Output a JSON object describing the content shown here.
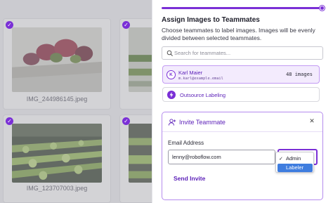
{
  "gallery": {
    "images": [
      {
        "filename": "",
        "checked": true
      },
      {
        "filename": "",
        "checked": true
      },
      {
        "filename": "IMG_244986145.jpeg",
        "checked": true
      },
      {
        "filename": "",
        "checked": true
      },
      {
        "filename": "IMG_123707003.jpeg",
        "checked": true
      },
      {
        "filename": "",
        "checked": true
      }
    ]
  },
  "assign": {
    "title": "Assign Images to Teammates",
    "description": "Choose teammates to label images. Images will be evenly divided between selected teammates.",
    "search_placeholder": "Search for teammates...",
    "teammate": {
      "initial": "K",
      "name": "Karl Maier",
      "email": "m.karl@example.email",
      "count": "48 images"
    },
    "outsource_label": "Outsource Labeling"
  },
  "invite": {
    "title": "Invite Teammate",
    "email_label": "Email Address",
    "email_value": "lenny@roboflow.com",
    "role_options": [
      "Admin",
      "Labeler"
    ],
    "selected_role": "Admin",
    "highlighted_role": "Labeler",
    "send_label": "Send Invite"
  },
  "colors": {
    "accent": "#7a2fd6",
    "accent_light": "#f3ebfd",
    "highlight": "#3f7ddf"
  },
  "icons": {
    "check": "check-icon",
    "search": "search-icon",
    "bolt": "bolt-icon",
    "add_person": "add-person-icon",
    "close": "close-icon"
  }
}
